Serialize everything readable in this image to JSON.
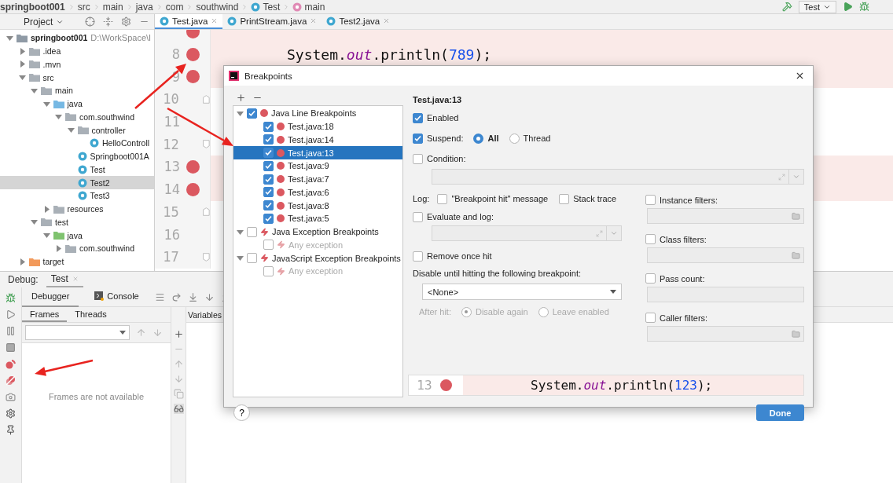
{
  "breadcrumbs": [
    {
      "label": "springboot001",
      "kind": "module"
    },
    {
      "label": "src",
      "kind": "plain"
    },
    {
      "label": "main",
      "kind": "plain"
    },
    {
      "label": "java",
      "kind": "plain"
    },
    {
      "label": "com",
      "kind": "plain"
    },
    {
      "label": "southwind",
      "kind": "plain"
    },
    {
      "label": "Test",
      "kind": "class"
    },
    {
      "label": "main",
      "kind": "method"
    }
  ],
  "run_config": "Test",
  "project_panel": {
    "title": "Project",
    "tree": [
      {
        "label": "springboot001",
        "hint": "D:\\WorkSpace\\I",
        "kind": "module",
        "expanded": true,
        "selected": false,
        "children": [
          {
            "label": ".idea",
            "kind": "folder",
            "expanded": false,
            "selected": false
          },
          {
            "label": ".mvn",
            "kind": "folder",
            "expanded": false,
            "selected": false
          },
          {
            "label": "src",
            "kind": "folder",
            "expanded": true,
            "selected": false,
            "children": [
              {
                "label": "main",
                "kind": "folder",
                "expanded": true,
                "selected": false,
                "children": [
                  {
                    "label": "java",
                    "kind": "source",
                    "expanded": true,
                    "selected": false,
                    "children": [
                      {
                        "label": "com.southwind",
                        "kind": "package",
                        "expanded": true,
                        "selected": false,
                        "children": [
                          {
                            "label": "controller",
                            "kind": "package",
                            "expanded": true,
                            "selected": false,
                            "children": [
                              {
                                "label": "HelloControll",
                                "kind": "class",
                                "selected": false
                              }
                            ]
                          },
                          {
                            "label": "Springboot001A",
                            "kind": "class",
                            "selected": false
                          },
                          {
                            "label": "Test",
                            "kind": "class",
                            "selected": false
                          },
                          {
                            "label": "Test2",
                            "kind": "class",
                            "selected": true
                          },
                          {
                            "label": "Test3",
                            "kind": "class",
                            "selected": false
                          }
                        ]
                      }
                    ]
                  },
                  {
                    "label": "resources",
                    "kind": "resources",
                    "expanded": false,
                    "selected": false
                  }
                ]
              },
              {
                "label": "test",
                "kind": "folder",
                "expanded": true,
                "selected": false,
                "children": [
                  {
                    "label": "java",
                    "kind": "test",
                    "expanded": true,
                    "selected": false,
                    "children": [
                      {
                        "label": "com.southwind",
                        "kind": "package",
                        "expanded": false,
                        "selected": false
                      }
                    ]
                  }
                ]
              }
            ]
          },
          {
            "label": "target",
            "kind": "excluded",
            "expanded": false,
            "selected": false
          }
        ]
      }
    ]
  },
  "editor": {
    "tabs": [
      {
        "label": "Test.java",
        "selected": true
      },
      {
        "label": "PrintStream.java",
        "selected": false
      },
      {
        "label": "Test2.java",
        "selected": false
      }
    ],
    "lines": [
      {
        "breakpoint": true
      },
      {
        "number": "8",
        "breakpoint": true,
        "code": [
          {
            "text": "System."
          },
          {
            "text": "out",
            "kind": "field"
          },
          {
            "text": ".println("
          },
          {
            "text": "789",
            "kind": "number"
          },
          {
            "text": ");"
          }
        ]
      },
      {
        "number": "9",
        "breakpoint": true
      },
      {
        "number": "10",
        "breakpoint": false,
        "kind": "fold-start"
      },
      {
        "number": "11",
        "breakpoint": false
      },
      {
        "number": "12",
        "breakpoint": false,
        "kind": "fold-end"
      },
      {
        "number": "13",
        "breakpoint": true
      },
      {
        "number": "14",
        "breakpoint": true
      },
      {
        "number": "15",
        "breakpoint": false,
        "kind": "fold-start"
      },
      {
        "number": "16",
        "breakpoint": false
      },
      {
        "number": "17",
        "breakpoint": false,
        "kind": "fold-end"
      }
    ]
  },
  "debug": {
    "title": "Debug:",
    "session": "Test",
    "tabs": [
      {
        "label": "Debugger",
        "selected": true
      },
      {
        "label": "Console",
        "selected": false
      }
    ],
    "frame_tabs": [
      {
        "label": "Frames",
        "selected": true
      },
      {
        "label": "Threads",
        "selected": false
      }
    ],
    "variables_title": "Variables",
    "empty_message": "Frames are not available"
  },
  "dialog": {
    "title": "Breakpoints",
    "tree": [
      {
        "label": "Java Line Breakpoints",
        "kind": "line",
        "checked": true,
        "expanded": true,
        "children": [
          {
            "label": "Test.java:18",
            "checked": true,
            "selected": false
          },
          {
            "label": "Test.java:14",
            "checked": true,
            "selected": false
          },
          {
            "label": "Test.java:13",
            "checked": true,
            "selected": true
          },
          {
            "label": "Test.java:9",
            "checked": true,
            "selected": false
          },
          {
            "label": "Test.java:7",
            "checked": true,
            "selected": false
          },
          {
            "label": "Test.java:6",
            "checked": true,
            "selected": false
          },
          {
            "label": "Test.java:8",
            "checked": true,
            "selected": false
          },
          {
            "label": "Test.java:5",
            "checked": true,
            "selected": false
          }
        ]
      },
      {
        "label": "Java Exception Breakpoints",
        "kind": "exception",
        "checked": false,
        "expanded": true,
        "children": [
          {
            "label": "Any exception",
            "checked": false,
            "selected": false,
            "disabled": true
          }
        ]
      },
      {
        "label": "JavaScript Exception Breakpoints",
        "kind": "exception",
        "checked": false,
        "expanded": true,
        "children": [
          {
            "label": "Any exception",
            "checked": false,
            "selected": false,
            "disabled": true
          }
        ]
      }
    ],
    "details": {
      "heading": "Test.java:13",
      "enabled": {
        "label": "Enabled",
        "checked": true
      },
      "suspend": {
        "label": "Suspend:",
        "checked": true,
        "options": [
          {
            "label": "All",
            "selected": true
          },
          {
            "label": "Thread",
            "selected": false
          }
        ]
      },
      "condition": {
        "label": "Condition:",
        "checked": false
      },
      "log": {
        "label": "Log:",
        "options": [
          {
            "label": "\"Breakpoint hit\" message",
            "checked": false
          },
          {
            "label": "Stack trace",
            "checked": false
          }
        ]
      },
      "evaluate": {
        "label": "Evaluate and log:",
        "checked": false
      },
      "remove_once_hit": {
        "label": "Remove once hit",
        "checked": false
      },
      "disable_until": {
        "label": "Disable until hitting the following breakpoint:",
        "value": "<None>"
      },
      "after_hit": {
        "label": "After hit:",
        "disabled": true,
        "options": [
          {
            "label": "Disable again",
            "selected": true
          },
          {
            "label": "Leave enabled",
            "selected": false
          }
        ]
      },
      "filters": [
        {
          "label": "Instance filters:",
          "checked": false,
          "kind": "browse"
        },
        {
          "label": "Class filters:",
          "checked": false,
          "kind": "browse"
        },
        {
          "label": "Pass count:",
          "checked": false,
          "kind": "plain"
        },
        {
          "label": "Caller filters:",
          "checked": false,
          "kind": "browse"
        }
      ]
    },
    "preview": {
      "number": "13",
      "code": [
        {
          "text": "System."
        },
        {
          "text": "out",
          "kind": "field"
        },
        {
          "text": ".println("
        },
        {
          "text": "123",
          "kind": "number"
        },
        {
          "text": ");"
        }
      ]
    },
    "help": "?",
    "done": "Done"
  }
}
